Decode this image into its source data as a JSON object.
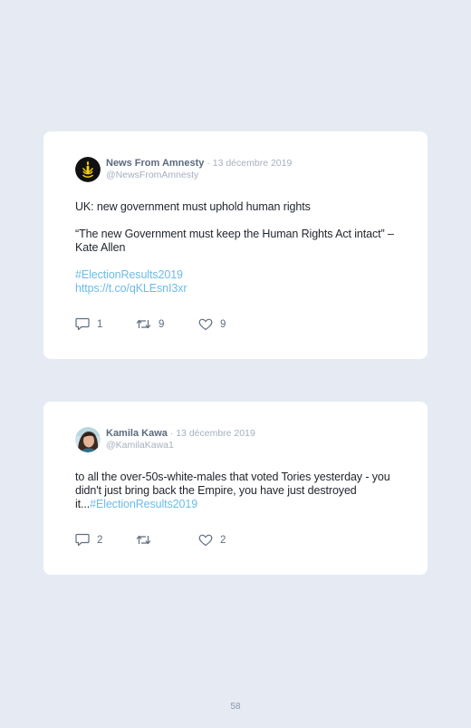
{
  "tweets": [
    {
      "author": "News From Amnesty",
      "separator": " · ",
      "date": "13 décembre 2019",
      "handle": "@NewsFromAmnesty",
      "avatar_icon": "amnesty-candle-logo",
      "lines": [
        "UK: new government must uphold human rights",
        "",
        "“The new Government must keep the Human Rights Act intact” – Kate Allen",
        "",
        "#ElectionResults2019",
        "https://t.co/qKLEsnI3xr"
      ],
      "replies": "1",
      "retweets": "9",
      "likes": "9"
    },
    {
      "author": "Kamila Kawa",
      "separator": " · ",
      "date": "13 décembre 2019",
      "handle": "@KamilaKawa1",
      "avatar_icon": "profile-photo",
      "text": "to all the over-50s-white-males that voted Tories yesterday - you didn't just bring back the Empire, you have just destroyed it...",
      "hashtag": "#ElectionResults2019",
      "replies": "2",
      "retweets": "",
      "likes": "2"
    }
  ],
  "page_number": "58",
  "colors": {
    "background": "#e6ebf3",
    "card": "#ffffff",
    "link": "#6cbce9",
    "muted": "#a5b0be",
    "name": "#5b6a7d"
  }
}
